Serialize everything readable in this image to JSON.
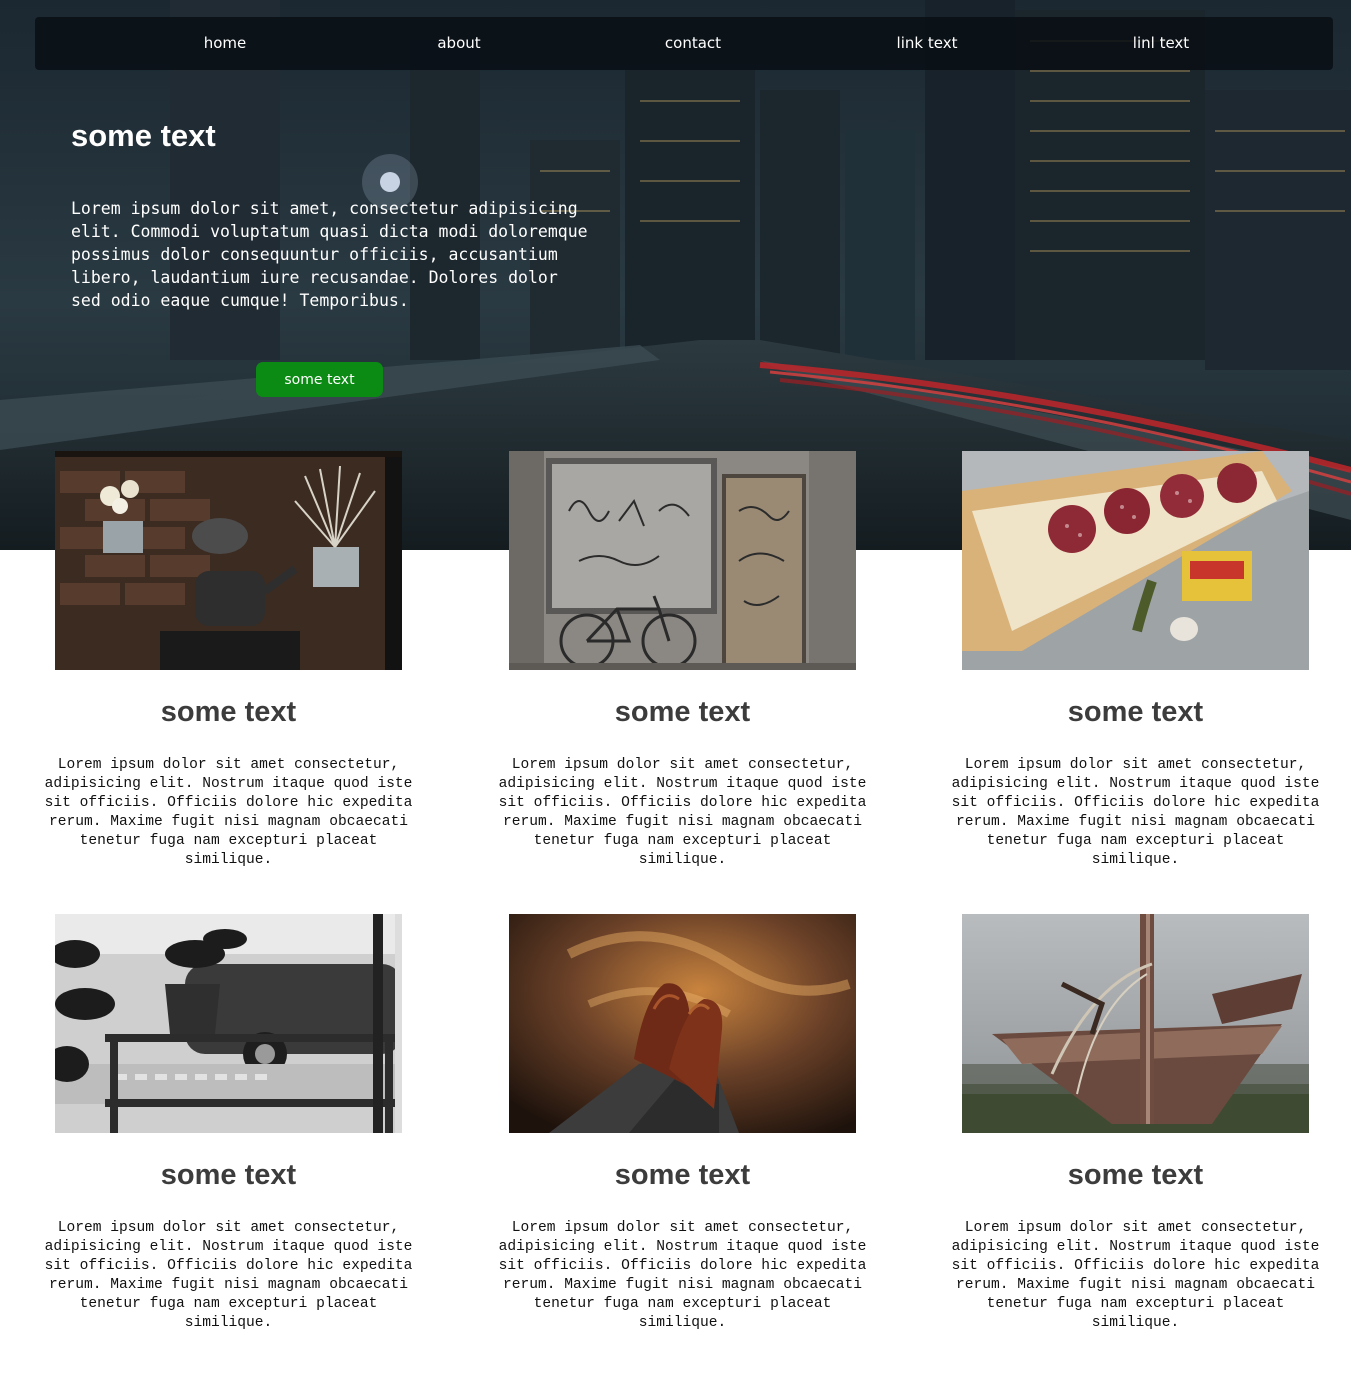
{
  "nav": {
    "items": [
      {
        "label": "home"
      },
      {
        "label": "about"
      },
      {
        "label": "contact"
      },
      {
        "label": "link text"
      },
      {
        "label": "linl text"
      }
    ]
  },
  "hero": {
    "title": "some text",
    "body": "Lorem ipsum dolor sit amet, consectetur adipisicing elit. Commodi voluptatum quasi dicta modi doloremque possimus dolor consequuntur officiis, accusantium libero, laudantium iure recusandae. Dolores dolor sed odio eaque cumque! Temporibus.",
    "button_label": "some text",
    "button_color": "#0b8a14"
  },
  "cards": [
    {
      "title": "some text",
      "body": "Lorem ipsum dolor sit amet consectetur, adipisicing elit. Nostrum itaque quod iste sit officiis. Officiis dolore hic expedita rerum. Maxime fugit nisi magnam obcaecati tenetur fuga nam excepturi placeat similique."
    },
    {
      "title": "some text",
      "body": "Lorem ipsum dolor sit amet consectetur, adipisicing elit. Nostrum itaque quod iste sit officiis. Officiis dolore hic expedita rerum. Maxime fugit nisi magnam obcaecati tenetur fuga nam excepturi placeat similique."
    },
    {
      "title": "some text",
      "body": "Lorem ipsum dolor sit amet consectetur, adipisicing elit. Nostrum itaque quod iste sit officiis. Officiis dolore hic expedita rerum. Maxime fugit nisi magnam obcaecati tenetur fuga nam excepturi placeat similique."
    },
    {
      "title": "some text",
      "body": "Lorem ipsum dolor sit amet consectetur, adipisicing elit. Nostrum itaque quod iste sit officiis. Officiis dolore hic expedita rerum. Maxime fugit nisi magnam obcaecati tenetur fuga nam excepturi placeat similique."
    },
    {
      "title": "some text",
      "body": "Lorem ipsum dolor sit amet consectetur, adipisicing elit. Nostrum itaque quod iste sit officiis. Officiis dolore hic expedita rerum. Maxime fugit nisi magnam obcaecati tenetur fuga nam excepturi placeat similique."
    },
    {
      "title": "some text",
      "body": "Lorem ipsum dolor sit amet consectetur, adipisicing elit. Nostrum itaque quod iste sit officiis. Officiis dolore hic expedita rerum. Maxime fugit nisi magnam obcaecati tenetur fuga nam excepturi placeat similique."
    }
  ]
}
